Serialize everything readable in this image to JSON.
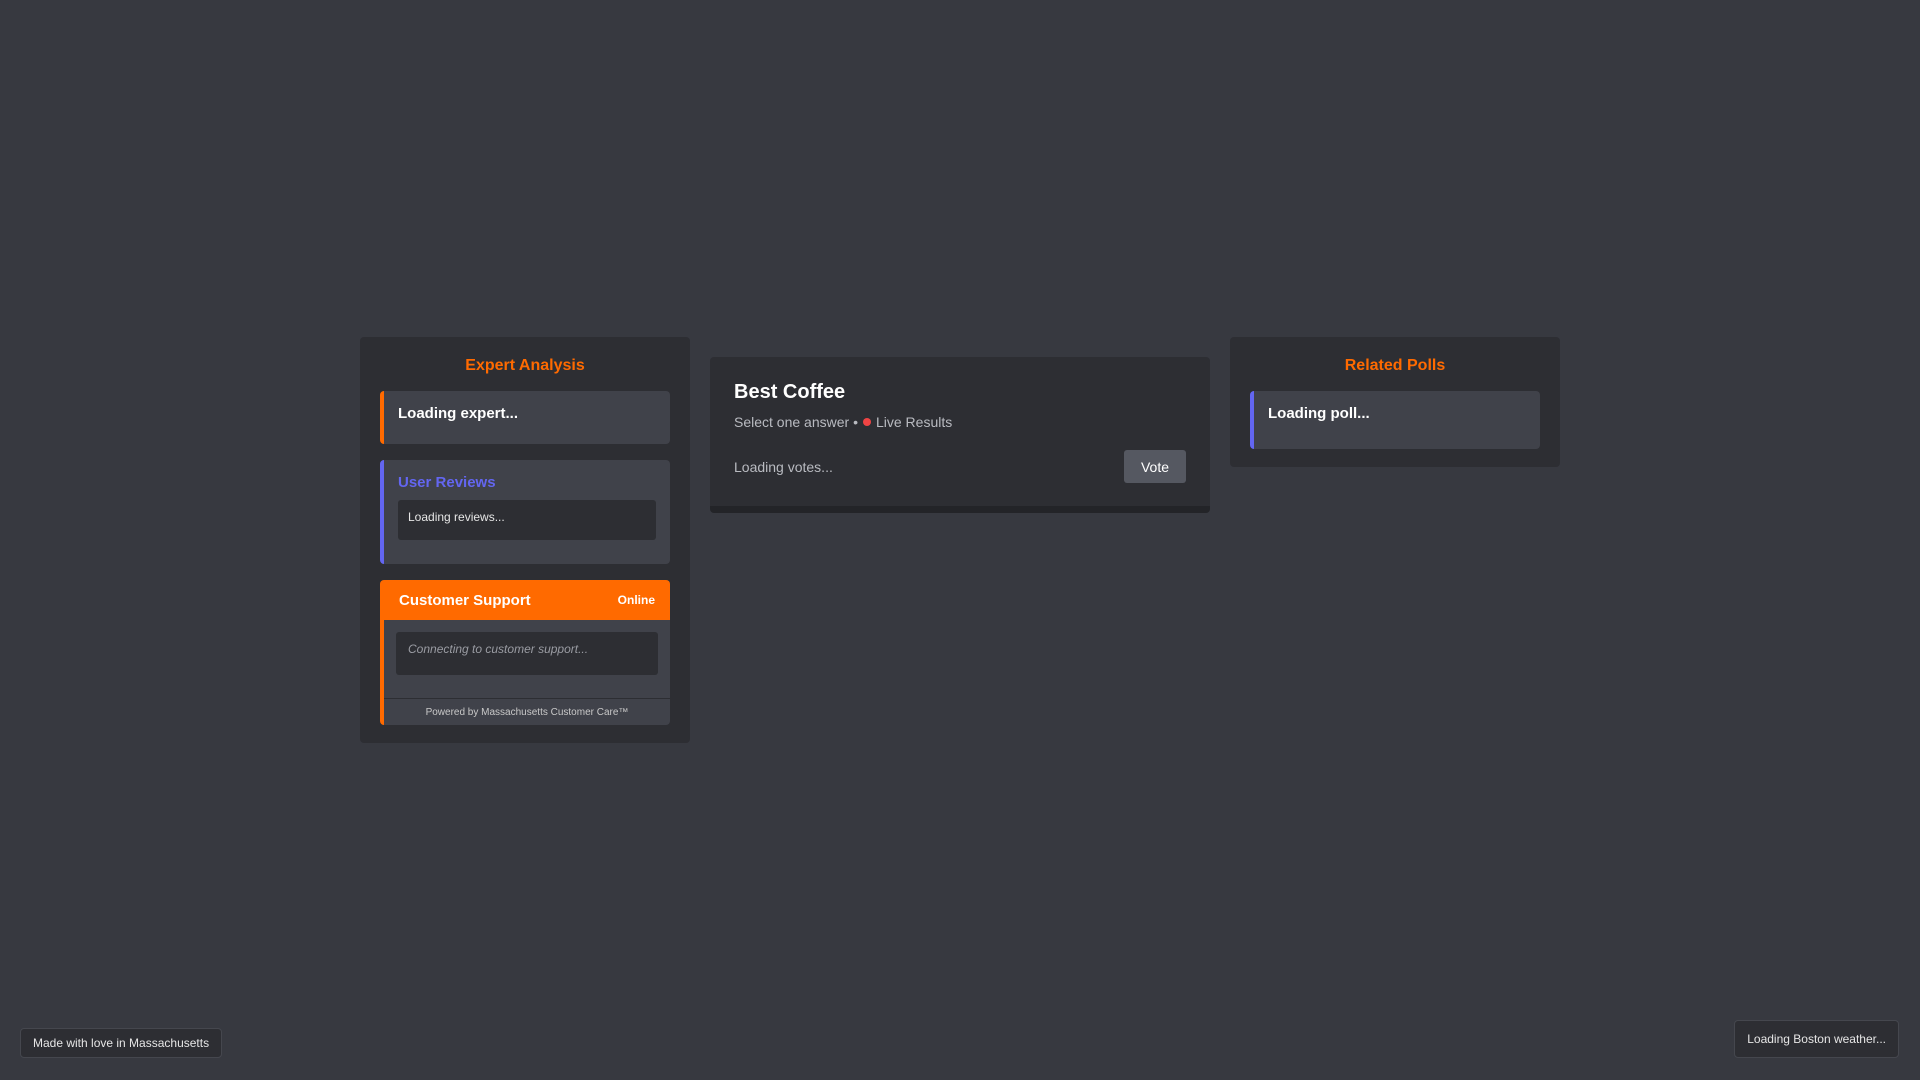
{
  "expert": {
    "title": "Expert Analysis",
    "loading": "Loading expert..."
  },
  "reviews": {
    "title": "User Reviews",
    "loading": "Loading reviews..."
  },
  "support": {
    "title": "Customer Support",
    "status": "Online",
    "placeholder": "Connecting to customer support...",
    "footer": "Powered by Massachusetts Customer Care™"
  },
  "poll": {
    "title": "Best Coffee",
    "subtitle_prefix": "Select one answer •",
    "live_label": "Live Results",
    "votes_loading": "Loading votes...",
    "vote_label": "Vote"
  },
  "related": {
    "title": "Related Polls",
    "loading": "Loading poll..."
  },
  "footer": {
    "made_with": "Made with love in Massachusetts",
    "weather": "Loading Boston weather..."
  },
  "colors": {
    "accent": "#ff6a00",
    "secondary_accent": "#6366f1",
    "live": "#ef4444",
    "background": "#373940",
    "panel": "#2d2e33"
  }
}
